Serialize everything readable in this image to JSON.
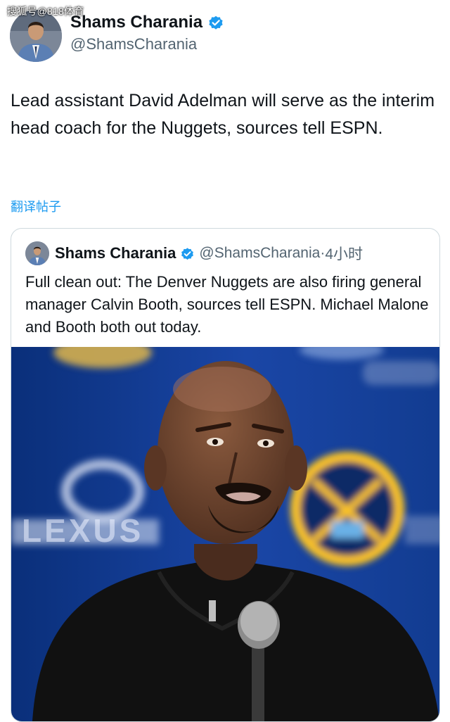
{
  "watermark": "搜狐号@818体育",
  "author": {
    "name": "Shams Charania",
    "handle": "@ShamsCharania",
    "verified": true,
    "avatar_icon": "profile-photo"
  },
  "tweet": {
    "text": "Lead assistant David Adelman will serve as the interim head coach for the Nuggets, sources tell ESPN.",
    "translate_label": "翻译帖子"
  },
  "quoted": {
    "name": "Shams Charania",
    "handle": "@ShamsCharania",
    "separator": "·",
    "time": "4小时",
    "text": "Full clean out: The Denver Nuggets are also firing general manager Calvin Booth, sources tell ESPN. Michael Malone and Booth both out today.",
    "image_logo_text": "LEXUS"
  },
  "colors": {
    "verified": "#1d9bf0",
    "link": "#1d9bf0",
    "secondary_text": "#536471",
    "border": "#cfd9de",
    "nuggets_gold": "#fec524",
    "backdrop_blue": "#0e3a8c"
  }
}
